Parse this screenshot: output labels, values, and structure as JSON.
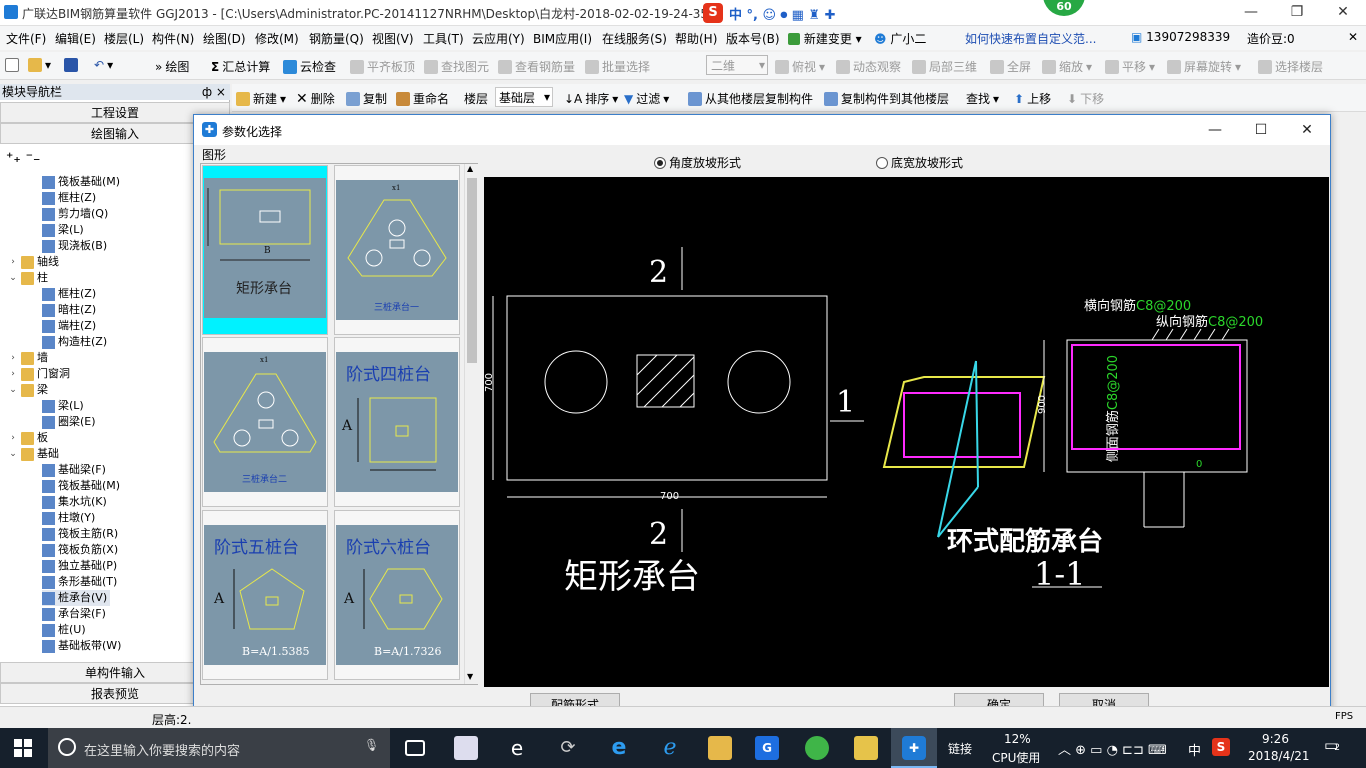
{
  "window": {
    "title": "广联达BIM钢筋算量软件 GGJ2013 - [C:\\Users\\Administrator.PC-20141127NRHM\\Desktop\\白龙村-2018-02-02-19-24-35",
    "badge": "60"
  },
  "menus": [
    "文件(F)",
    "编辑(E)",
    "楼层(L)",
    "构件(N)",
    "绘图(D)",
    "修改(M)",
    "钢筋量(Q)",
    "视图(V)",
    "工具(T)",
    "云应用(Y)",
    "BIM应用(I)",
    "在线服务(S)",
    "帮助(H)",
    "版本号(B)",
    "新建变更",
    "广小二"
  ],
  "menu_right": {
    "help_link": "如何快速布置自定义范...",
    "phone": "13907298339",
    "coins": "造价豆:0"
  },
  "toolbar1": {
    "draw": "绘图",
    "sum": "汇总计算",
    "cloud_check": "云检查",
    "flat_top": "平齐板顶",
    "find_elem": "查找图元",
    "view_rebar": "查看钢筋量",
    "batch_select": "批量选择",
    "view_mode": "二维",
    "top_view": "俯视",
    "dyn_view": "动态观察",
    "local_3d": "局部三维",
    "fullscreen": "全屏",
    "zoom": "缩放",
    "pan": "平移",
    "rotate": "屏幕旋转",
    "select_floor": "选择楼层"
  },
  "toolbar2": {
    "new": "新建",
    "delete": "删除",
    "copy": "复制",
    "rename": "重命名",
    "floor_label": "楼层",
    "floor_value": "基础层",
    "sort": "排序",
    "filter": "过滤",
    "copy_from": "从其他楼层复制构件",
    "copy_to": "复制构件到其他楼层",
    "find": "查找",
    "move_up": "上移",
    "move_down": "下移"
  },
  "leftnav": {
    "title": "模块导航栏",
    "pin": "ф × ",
    "top_buttons": [
      "工程设置",
      "绘图输入"
    ],
    "bottom_buttons": [
      "单构件输入",
      "报表预览"
    ],
    "tree": [
      {
        "level": 2,
        "exp": "",
        "icon": "leaf",
        "label": "筏板基础(M)"
      },
      {
        "level": 2,
        "exp": "",
        "icon": "leaf",
        "label": "框柱(Z)"
      },
      {
        "level": 2,
        "exp": "",
        "icon": "leaf",
        "label": "剪力墙(Q)"
      },
      {
        "level": 2,
        "exp": "",
        "icon": "leaf",
        "label": "梁(L)"
      },
      {
        "level": 2,
        "exp": "",
        "icon": "leaf",
        "label": "现浇板(B)"
      },
      {
        "level": 1,
        "exp": "›",
        "icon": "folder",
        "label": "轴线"
      },
      {
        "level": 1,
        "exp": "⌄",
        "icon": "folder",
        "label": "柱"
      },
      {
        "level": 2,
        "exp": "",
        "icon": "leaf",
        "label": "框柱(Z)"
      },
      {
        "level": 2,
        "exp": "",
        "icon": "leaf",
        "label": "暗柱(Z)"
      },
      {
        "level": 2,
        "exp": "",
        "icon": "leaf",
        "label": "端柱(Z)"
      },
      {
        "level": 2,
        "exp": "",
        "icon": "leaf",
        "label": "构造柱(Z)"
      },
      {
        "level": 1,
        "exp": "›",
        "icon": "folder",
        "label": "墙"
      },
      {
        "level": 1,
        "exp": "›",
        "icon": "folder",
        "label": "门窗洞"
      },
      {
        "level": 1,
        "exp": "⌄",
        "icon": "folder",
        "label": "梁"
      },
      {
        "level": 2,
        "exp": "",
        "icon": "leaf",
        "label": "梁(L)"
      },
      {
        "level": 2,
        "exp": "",
        "icon": "leaf",
        "label": "圈梁(E)"
      },
      {
        "level": 1,
        "exp": "›",
        "icon": "folder",
        "label": "板"
      },
      {
        "level": 1,
        "exp": "⌄",
        "icon": "folder",
        "label": "基础"
      },
      {
        "level": 2,
        "exp": "",
        "icon": "leaf",
        "label": "基础梁(F)"
      },
      {
        "level": 2,
        "exp": "",
        "icon": "leaf",
        "label": "筏板基础(M)"
      },
      {
        "level": 2,
        "exp": "",
        "icon": "leaf",
        "label": "集水坑(K)"
      },
      {
        "level": 2,
        "exp": "",
        "icon": "leaf",
        "label": "柱墩(Y)"
      },
      {
        "level": 2,
        "exp": "",
        "icon": "leaf",
        "label": "筏板主筋(R)"
      },
      {
        "level": 2,
        "exp": "",
        "icon": "leaf",
        "label": "筏板负筋(X)"
      },
      {
        "level": 2,
        "exp": "",
        "icon": "leaf",
        "label": "独立基础(P)"
      },
      {
        "level": 2,
        "exp": "",
        "icon": "leaf",
        "label": "条形基础(T)"
      },
      {
        "level": 2,
        "exp": "",
        "icon": "leaf",
        "label": "桩承台(V)"
      },
      {
        "level": 2,
        "exp": "",
        "icon": "leaf",
        "label": "承台梁(F)"
      },
      {
        "level": 2,
        "exp": "",
        "icon": "leaf",
        "label": "桩(U)"
      },
      {
        "level": 2,
        "exp": "",
        "icon": "leaf",
        "label": "基础板带(W)"
      }
    ]
  },
  "dialog": {
    "title": "参数化选择",
    "gallery_label": "图形",
    "radio_angle": "角度放坡形式",
    "radio_bottom": "底宽放坡形式",
    "thumbs": [
      {
        "title": "矩形承台",
        "dim": "B"
      },
      {
        "title": "三桩承台一",
        "dim": "x1"
      },
      {
        "title": "三桩承台二",
        "dim": "x1"
      },
      {
        "title": "阶式四桩台",
        "dim": "A"
      },
      {
        "title": "阶式五桩台",
        "dim": "A",
        "formula": "B=A/1.5385"
      },
      {
        "title": "阶式六桩台",
        "dim": "A",
        "formula": "B=A/1.7326"
      }
    ],
    "preview": {
      "section_mark_1": "1",
      "section_mark_2_top": "2",
      "section_mark_2_bottom": "2",
      "dim_height": "700",
      "dim_width": "700",
      "plan_title": "矩形承台",
      "rebar_transverse": "横向钢筋",
      "rebar_transverse_val": "C8@200",
      "rebar_longitudinal": "纵向钢筋",
      "rebar_longitudinal_val": "C8@200",
      "rebar_side": "侧面钢筋",
      "rebar_side_val": "C8@200",
      "dim_900": "900",
      "dim_0": "0",
      "section_title": "环式配筋承台",
      "section_label": "1-1"
    },
    "btn_rebar_form": "配筋形式",
    "btn_ok": "确定",
    "btn_cancel": "取消"
  },
  "statusbar": {
    "floor_height": "层高:2.",
    "fps": "FPS"
  },
  "taskbar": {
    "search_placeholder": "在这里输入你要搜索的内容",
    "link": "链接",
    "cpu_pct": "12%",
    "cpu_label": "CPU使用",
    "ime": "中",
    "time": "9:26",
    "date": "2018/4/21",
    "notif": "2"
  }
}
